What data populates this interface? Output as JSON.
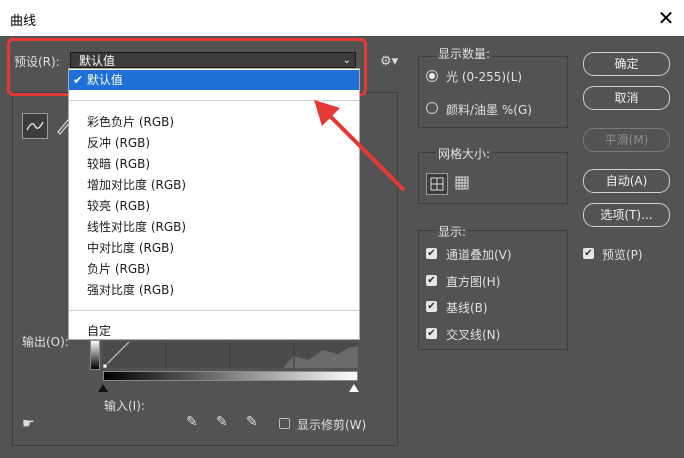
{
  "window": {
    "title": "曲线",
    "close_glyph": "✕"
  },
  "preset": {
    "label": "预设(R):",
    "value": "默认值",
    "options": [
      {
        "label": "默认值",
        "selected": true
      },
      {
        "label": "彩色负片 (RGB)"
      },
      {
        "label": "反冲 (RGB)"
      },
      {
        "label": "较暗 (RGB)"
      },
      {
        "label": "增加对比度 (RGB)"
      },
      {
        "label": "较亮 (RGB)"
      },
      {
        "label": "线性对比度 (RGB)"
      },
      {
        "label": "中对比度 (RGB)"
      },
      {
        "label": "负片 (RGB)"
      },
      {
        "label": "强对比度 (RGB)"
      },
      {
        "label": "自定"
      }
    ]
  },
  "curves": {
    "output_label": "输出(O):",
    "input_label": "输入(I):",
    "show_clipping_label": "显示修剪(W)",
    "show_clipping_checked": false
  },
  "display_amount": {
    "label": "显示数量:",
    "options": [
      {
        "label": "光 (0-255)(L)",
        "selected": true
      },
      {
        "label": "颜料/油墨 %(G)",
        "selected": false
      }
    ]
  },
  "grid_size": {
    "label": "网格大小:"
  },
  "show": {
    "label": "显示:",
    "items": [
      {
        "label": "通道叠加(V)",
        "checked": true
      },
      {
        "label": "直方图(H)",
        "checked": true
      },
      {
        "label": "基线(B)",
        "checked": true
      },
      {
        "label": "交叉线(N)",
        "checked": true
      }
    ]
  },
  "buttons": {
    "ok": "确定",
    "cancel": "取消",
    "smooth": "平滑(M)",
    "auto": "自动(A)",
    "options": "选项(T)..."
  },
  "preview": {
    "label": "预览(P)",
    "checked": true
  },
  "colors": {
    "annotation_red": "#e53935",
    "highlight": "#1e70d8",
    "dialog_bg": "#535353"
  }
}
